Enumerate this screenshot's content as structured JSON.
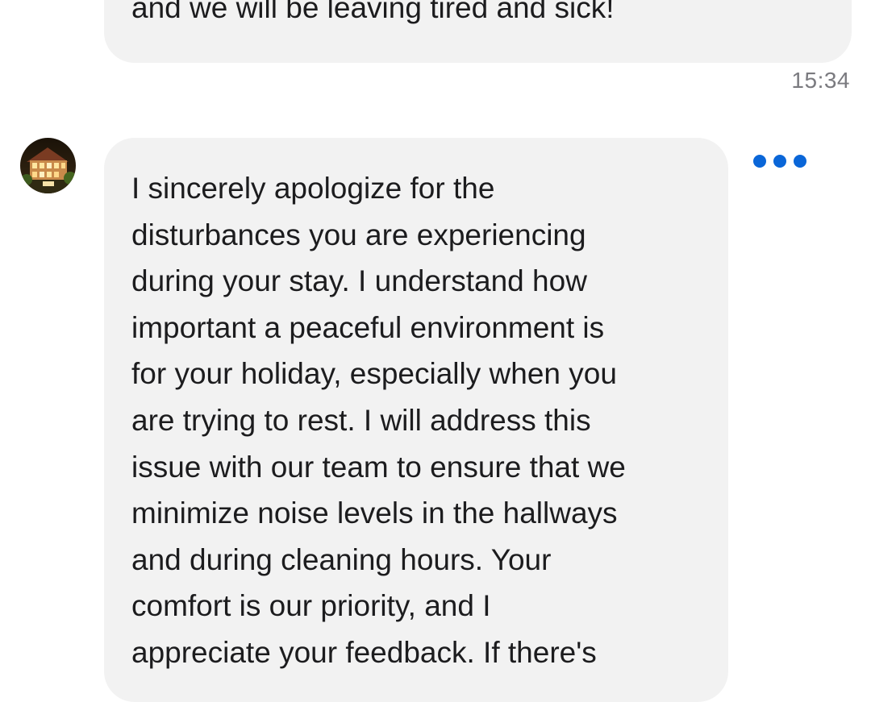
{
  "conversation": {
    "outgoing_message": {
      "visible_text": "and we will be leaving tired and sick!",
      "timestamp": "15:34"
    },
    "incoming_message": {
      "avatar_icon": "hotel-photo-avatar",
      "more_icon": "ellipsis-icon",
      "accent_color": "#0a66d8",
      "lines": [
        "I sincerely apologize for the",
        "disturbances you are experiencing",
        "during your stay. I understand how",
        "important a peaceful environment is",
        "for your holiday, especially when you",
        "are trying to rest. I will address this",
        "issue with our team to ensure that we",
        "minimize noise levels in the hallways",
        "and during cleaning hours. Your",
        "comfort is our priority, and I",
        "appreciate your feedback. If there's"
      ]
    }
  }
}
